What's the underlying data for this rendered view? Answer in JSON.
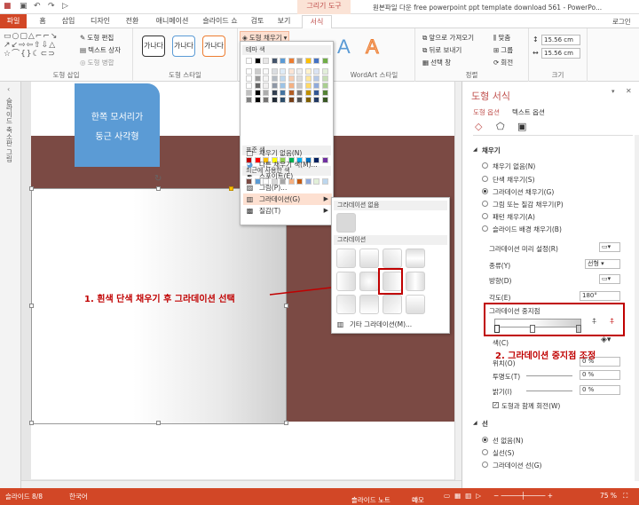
{
  "window": {
    "context_group": "그리기 도구",
    "title": "원본파일 다운 free powerpoint ppt template download 561 - PowerPo...",
    "account": "로그인"
  },
  "tabs": [
    "파일",
    "홈",
    "삽입",
    "디자인",
    "전환",
    "애니메이션",
    "슬라이드 쇼",
    "검토",
    "보기",
    "서식"
  ],
  "ribbon": {
    "insert_shapes": {
      "label": "도형 삽입",
      "edit_shape": "도형 편집",
      "text_box": "텍스트 상자",
      "merge_shapes": "도형 병합"
    },
    "shape_styles": {
      "label": "도형 스타일",
      "samples": [
        "가나다",
        "가나다",
        "가나다"
      ]
    },
    "shape_fill": "도형 채우기",
    "wordart": {
      "label": "WordArt 스타일",
      "samples": [
        "A",
        "A"
      ]
    },
    "arrange": {
      "label": "정렬",
      "bring_forward": "앞으로 가져오기",
      "send_backward": "뒤로 보내기",
      "selection_pane": "선택 창",
      "align": "맞춤",
      "group": "그룹",
      "rotate": "회전"
    },
    "size": {
      "label": "크기",
      "height": "15.56 cm",
      "width": "15.56 cm"
    }
  },
  "left_pane": {
    "thumbnails_label": "슬라이드 축소판 그림"
  },
  "slide": {
    "blue_shape_text": [
      "한쪽 모서리가",
      "둥근 사각형"
    ],
    "annotation_1": "1. 흰색 단색 채우기 후 그라데이션 선택"
  },
  "fill_dropdown": {
    "theme_colors_header": "테마 색",
    "standard_colors_header": "표준 색",
    "recent_colors_header": "최근에 사용한 색",
    "items": [
      "채우기 없음(N)",
      "다른 채우기 색(M)...",
      "스포이트(E)",
      "그림(P)...",
      "그라데이션(G)",
      "질감(T)"
    ],
    "theme_colors": [
      "#ffffff",
      "#000000",
      "#e7e6e6",
      "#44546a",
      "#5b9bd5",
      "#ed7d31",
      "#a5a5a5",
      "#ffc000",
      "#4472c4",
      "#70ad47"
    ],
    "standard_colors": [
      "#c00000",
      "#ff0000",
      "#ffc000",
      "#ffff00",
      "#92d050",
      "#00b050",
      "#00b0f0",
      "#0070c0",
      "#002060",
      "#7030a0"
    ],
    "recent_colors": [
      "#7b4a44",
      "#5b9bd5",
      "#ffffff",
      "#d9d9d9",
      "#a6a6a6",
      "#f4b183",
      "#c55a11",
      "#8faadc",
      "#e2f0d9",
      "#bdd7ee"
    ]
  },
  "gradient_submenu": {
    "none_header": "그라데이션 없음",
    "gradient_header": "그라데이션",
    "more": "기타 그라데이션(M)..."
  },
  "format_pane": {
    "title": "도형 서식",
    "tab_shape": "도형 옵션",
    "tab_text": "텍스트 옵션",
    "fill_section": "채우기",
    "fill_options": [
      "채우기 없음(N)",
      "단색 채우기(S)",
      "그라데이션 채우기(G)",
      "그림 또는 질감 채우기(P)",
      "패턴 채우기(A)",
      "슬라이드 배경 채우기(B)"
    ],
    "preset_label": "그라데이션 미리 설정(R)",
    "type_label": "종류(Y)",
    "type_value": "선형",
    "direction_label": "방향(D)",
    "angle_label": "각도(E)",
    "angle_value": "180°",
    "stops_label": "그라데이션 중지점",
    "color_label": "색(C)",
    "position_label": "위치(O)",
    "position_value": "0 %",
    "transparency_label": "투명도(T)",
    "transparency_value": "0 %",
    "brightness_label": "밝기(I)",
    "brightness_value": "0 %",
    "rotate_with_shape": "도형과 함께 회전(W)",
    "line_section": "선",
    "line_options": [
      "선 없음(N)",
      "실선(S)",
      "그라데이션 선(G)"
    ],
    "annotation_2": "2. 그라데이션 중지점 조정"
  },
  "status": {
    "slide": "슬라이드 8/8",
    "lang": "한국어",
    "notes": "슬라이드 노트",
    "comments": "메모",
    "zoom": "75 %"
  }
}
